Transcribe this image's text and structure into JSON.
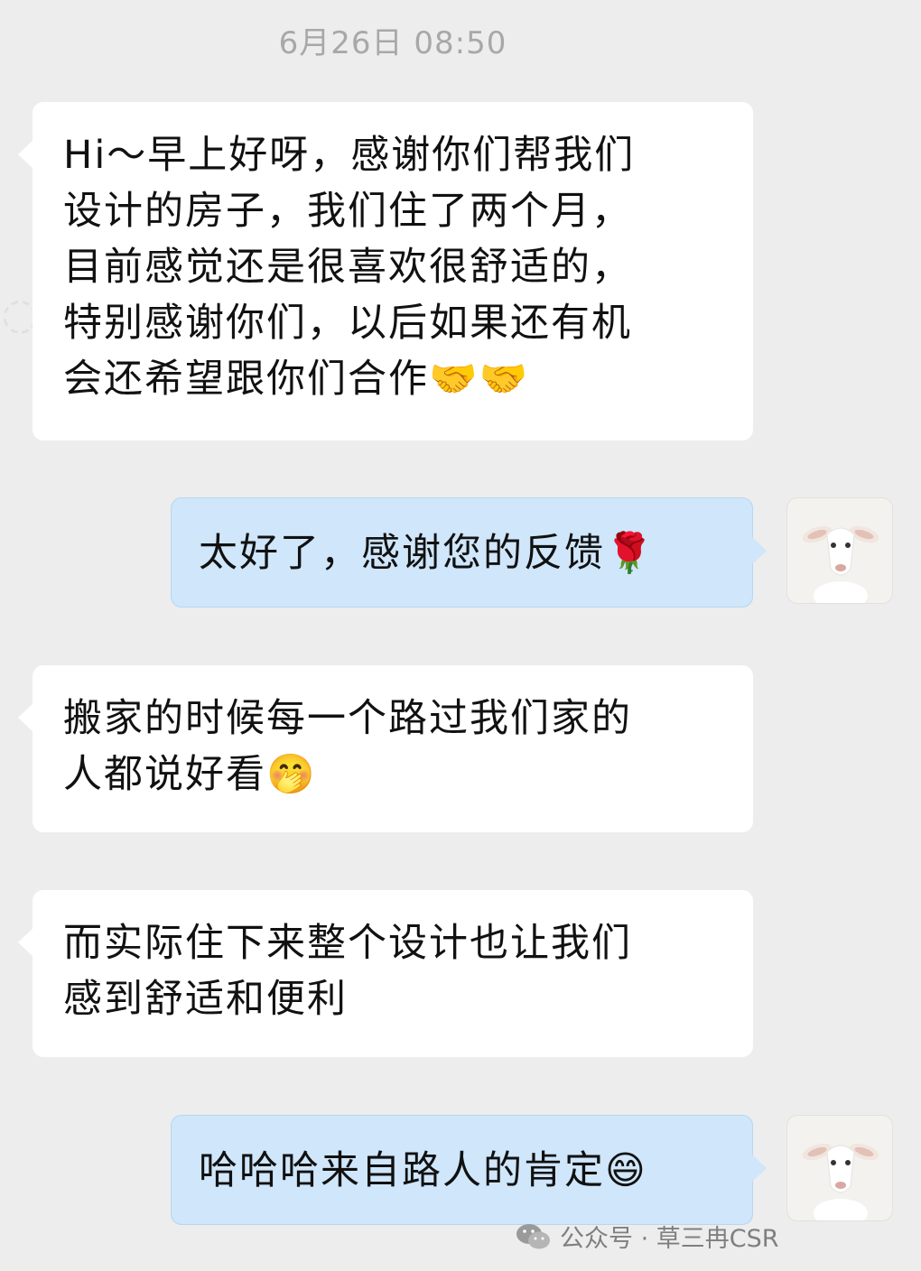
{
  "timestamp": "6月26日 08:50",
  "messages": [
    {
      "side": "in",
      "text": "Hi～早上好呀，感谢你们帮我们\n设计的房子，我们住了两个月，\n目前感觉还是很喜欢很舒适的，\n特别感谢你们，以后如果还有机\n会还希望跟你们合作🤝🤝"
    },
    {
      "side": "out",
      "text": "太好了，感谢您的反馈🌹"
    },
    {
      "side": "in",
      "text": "搬家的时候每一个路过我们家的\n人都说好看🤭"
    },
    {
      "side": "in",
      "text": "而实际住下来整个设计也让我们\n感到舒适和便利"
    },
    {
      "side": "out",
      "text": "哈哈哈来自路人的肯定😄"
    }
  ],
  "avatar_icon": "lamb-avatar-icon",
  "watermark": {
    "icon": "wechat-icon",
    "text": "公众号 · 草三冉CSR"
  },
  "colors": {
    "background": "#ededed",
    "incoming_bubble": "#ffffff",
    "outgoing_bubble": "#cfe6fb",
    "timestamp": "#a8a8a8"
  }
}
